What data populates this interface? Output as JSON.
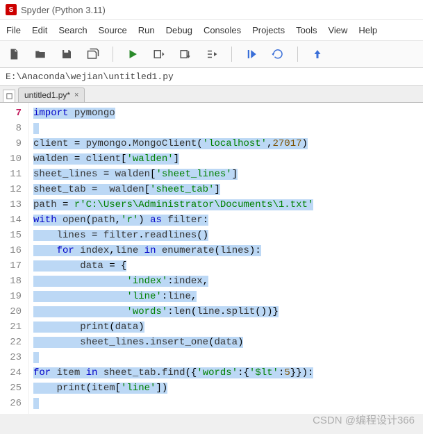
{
  "window": {
    "title": "Spyder (Python 3.11)"
  },
  "menu": [
    "File",
    "Edit",
    "Search",
    "Source",
    "Run",
    "Debug",
    "Consoles",
    "Projects",
    "Tools",
    "View",
    "Help"
  ],
  "path": "E:\\Anaconda\\wejian\\untitled1.py",
  "tab": {
    "label": "untitled1.py*",
    "close": "×"
  },
  "gutter_start": 7,
  "gutter_count": 20,
  "current_line": 7,
  "code_lines": [
    [
      [
        "kw",
        "import"
      ],
      [
        "plain",
        " pymongo"
      ]
    ],
    [],
    [
      [
        "plain",
        "client "
      ],
      [
        "op",
        "="
      ],
      [
        "plain",
        " pymongo"
      ],
      [
        "op",
        "."
      ],
      [
        "plain",
        "MongoClient"
      ],
      [
        "op",
        "("
      ],
      [
        "str",
        "'localhost'"
      ],
      [
        "op",
        ","
      ],
      [
        "num",
        "27017"
      ],
      [
        "op",
        ")"
      ]
    ],
    [
      [
        "plain",
        "walden "
      ],
      [
        "op",
        "="
      ],
      [
        "plain",
        " client"
      ],
      [
        "op",
        "["
      ],
      [
        "str",
        "'walden'"
      ],
      [
        "op",
        "]"
      ]
    ],
    [
      [
        "plain",
        "sheet_lines "
      ],
      [
        "op",
        "="
      ],
      [
        "plain",
        " walden"
      ],
      [
        "op",
        "["
      ],
      [
        "str",
        "'sheet_lines'"
      ],
      [
        "op",
        "]"
      ]
    ],
    [
      [
        "plain",
        "sheet_tab "
      ],
      [
        "op",
        "="
      ],
      [
        "plain",
        "  walden"
      ],
      [
        "op",
        "["
      ],
      [
        "str",
        "'sheet_tab'"
      ],
      [
        "op",
        "]"
      ]
    ],
    [
      [
        "plain",
        "path "
      ],
      [
        "op",
        "="
      ],
      [
        "plain",
        " "
      ],
      [
        "str",
        "r'C:\\Users\\Administrator\\Documents\\1.txt'"
      ]
    ],
    [
      [
        "kw",
        "with"
      ],
      [
        "plain",
        " open"
      ],
      [
        "op",
        "("
      ],
      [
        "plain",
        "path"
      ],
      [
        "op",
        ","
      ],
      [
        "str",
        "'r'"
      ],
      [
        "op",
        ")"
      ],
      [
        "plain",
        " "
      ],
      [
        "kw",
        "as"
      ],
      [
        "plain",
        " filter"
      ],
      [
        "op",
        ":"
      ]
    ],
    [
      [
        "plain",
        "    lines "
      ],
      [
        "op",
        "="
      ],
      [
        "plain",
        " filter"
      ],
      [
        "op",
        "."
      ],
      [
        "plain",
        "readlines"
      ],
      [
        "op",
        "("
      ],
      [
        "op",
        ")"
      ]
    ],
    [
      [
        "plain",
        "    "
      ],
      [
        "kw",
        "for"
      ],
      [
        "plain",
        " index"
      ],
      [
        "op",
        ","
      ],
      [
        "plain",
        "line "
      ],
      [
        "kw",
        "in"
      ],
      [
        "plain",
        " enumerate"
      ],
      [
        "op",
        "("
      ],
      [
        "plain",
        "lines"
      ],
      [
        "op",
        ")"
      ],
      [
        "op",
        ":"
      ]
    ],
    [
      [
        "plain",
        "        data "
      ],
      [
        "op",
        "="
      ],
      [
        "plain",
        " "
      ],
      [
        "op",
        "{"
      ]
    ],
    [
      [
        "plain",
        "                "
      ],
      [
        "str",
        "'index'"
      ],
      [
        "op",
        ":"
      ],
      [
        "plain",
        "index"
      ],
      [
        "op",
        ","
      ]
    ],
    [
      [
        "plain",
        "                "
      ],
      [
        "str",
        "'line'"
      ],
      [
        "op",
        ":"
      ],
      [
        "plain",
        "line"
      ],
      [
        "op",
        ","
      ]
    ],
    [
      [
        "plain",
        "                "
      ],
      [
        "str",
        "'words'"
      ],
      [
        "op",
        ":"
      ],
      [
        "plain",
        "len"
      ],
      [
        "op",
        "("
      ],
      [
        "plain",
        "line"
      ],
      [
        "op",
        "."
      ],
      [
        "plain",
        "split"
      ],
      [
        "op",
        "("
      ],
      [
        "op",
        ")"
      ],
      [
        "op",
        ")"
      ],
      [
        "op",
        "}"
      ]
    ],
    [
      [
        "plain",
        "        print"
      ],
      [
        "op",
        "("
      ],
      [
        "plain",
        "data"
      ],
      [
        "op",
        ")"
      ]
    ],
    [
      [
        "plain",
        "        sheet_lines"
      ],
      [
        "op",
        "."
      ],
      [
        "plain",
        "insert_one"
      ],
      [
        "op",
        "("
      ],
      [
        "plain",
        "data"
      ],
      [
        "op",
        ")"
      ]
    ],
    [],
    [
      [
        "kw",
        "for"
      ],
      [
        "plain",
        " item "
      ],
      [
        "kw",
        "in"
      ],
      [
        "plain",
        " sheet_tab"
      ],
      [
        "op",
        "."
      ],
      [
        "plain",
        "find"
      ],
      [
        "op",
        "("
      ],
      [
        "op",
        "{"
      ],
      [
        "str",
        "'words'"
      ],
      [
        "op",
        ":"
      ],
      [
        "op",
        "{"
      ],
      [
        "str",
        "'$lt'"
      ],
      [
        "op",
        ":"
      ],
      [
        "num",
        "5"
      ],
      [
        "op",
        "}"
      ],
      [
        "op",
        "}"
      ],
      [
        "op",
        ")"
      ],
      [
        "op",
        ":"
      ]
    ],
    [
      [
        "plain",
        "    print"
      ],
      [
        "op",
        "("
      ],
      [
        "plain",
        "item"
      ],
      [
        "op",
        "["
      ],
      [
        "str",
        "'line'"
      ],
      [
        "op",
        "]"
      ],
      [
        "op",
        ")"
      ]
    ],
    []
  ],
  "watermark": "CSDN @编程设计366"
}
